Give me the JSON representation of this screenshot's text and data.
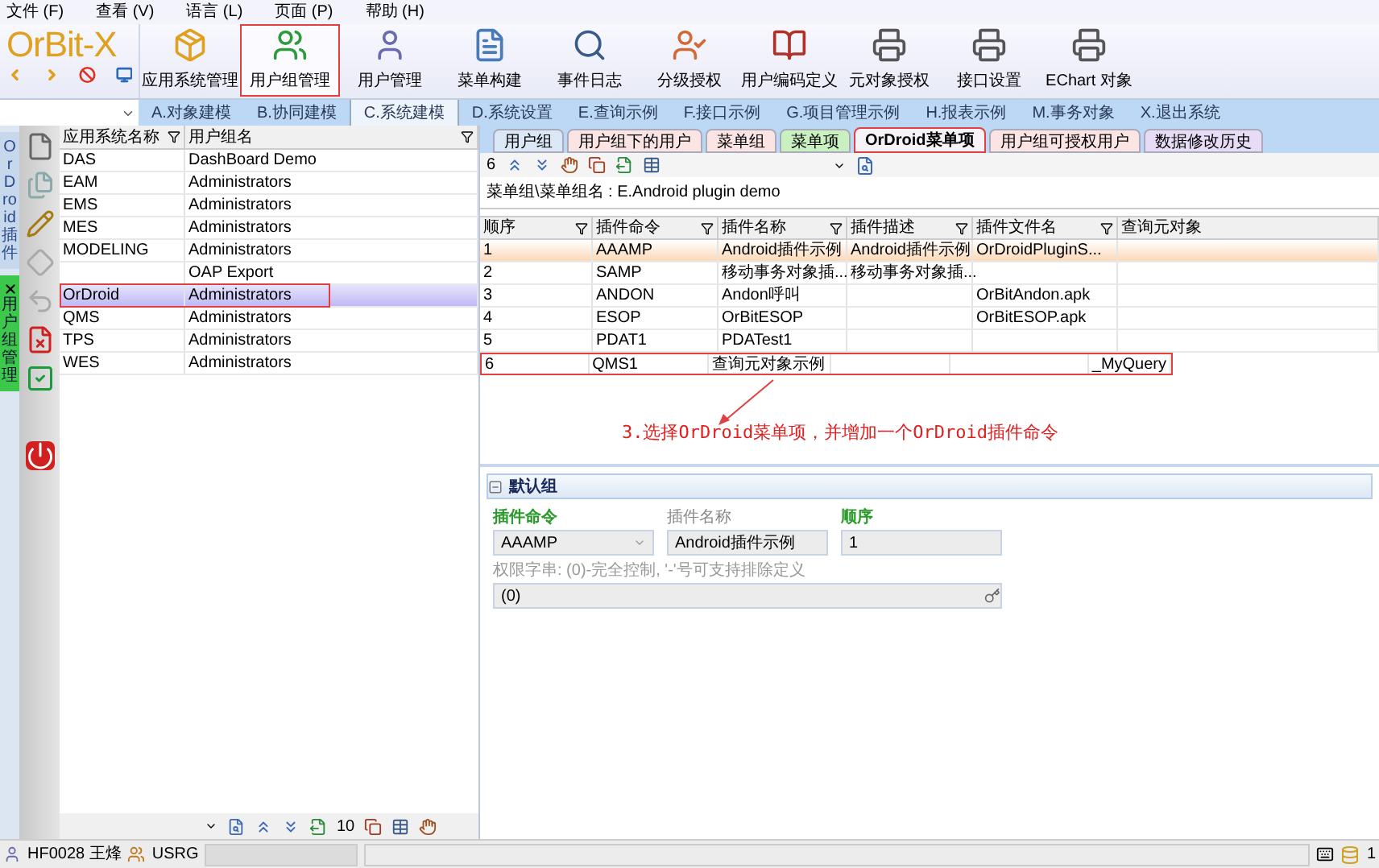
{
  "menu": [
    "文件 (F)",
    "查看 (V)",
    "语言 (L)",
    "页面 (P)",
    "帮助 (H)"
  ],
  "logo": "OrBit-X",
  "toolbar": [
    {
      "label": "应用系统管理",
      "annotated": false
    },
    {
      "label": "用户组管理",
      "annotated": true
    },
    {
      "label": "用户管理",
      "annotated": false
    },
    {
      "label": "菜单构建",
      "annotated": false
    },
    {
      "label": "事件日志",
      "annotated": false
    },
    {
      "label": "分级授权",
      "annotated": false
    },
    {
      "label": "用户编码定义",
      "annotated": false
    },
    {
      "label": "元对象授权",
      "annotated": false
    },
    {
      "label": "接口设置",
      "annotated": false
    },
    {
      "label": "EChart 对象",
      "annotated": false
    }
  ],
  "module_tabs": [
    {
      "label": "A.对象建模",
      "selected": false
    },
    {
      "label": "B.协同建模",
      "selected": false
    },
    {
      "label": "C.系统建模",
      "selected": true
    },
    {
      "label": "D.系统设置",
      "selected": false
    },
    {
      "label": "E.查询示例",
      "selected": false
    },
    {
      "label": "F.接口示例",
      "selected": false
    },
    {
      "label": "G.项目管理示例",
      "selected": false
    },
    {
      "label": "H.报表示例",
      "selected": false
    },
    {
      "label": "M.事务对象",
      "selected": false
    },
    {
      "label": "X.退出系统",
      "selected": false
    }
  ],
  "side_tabs": [
    {
      "label": "OrDroid插件",
      "selected": false
    },
    {
      "label": "用户组管理",
      "selected": true
    }
  ],
  "left_grid": {
    "columns": [
      "应用系统名称",
      "用户组名"
    ],
    "rows": [
      {
        "cells": [
          "DAS",
          "DashBoard Demo"
        ],
        "selected": false,
        "annotated": false
      },
      {
        "cells": [
          "EAM",
          "Administrators"
        ],
        "selected": false,
        "annotated": false
      },
      {
        "cells": [
          "EMS",
          "Administrators"
        ],
        "selected": false,
        "annotated": false
      },
      {
        "cells": [
          "MES",
          "Administrators"
        ],
        "selected": false,
        "annotated": false
      },
      {
        "cells": [
          "MODELING",
          "Administrators"
        ],
        "selected": false,
        "annotated": false
      },
      {
        "cells": [
          "",
          "OAP Export"
        ],
        "selected": false,
        "annotated": false
      },
      {
        "cells": [
          "OrDroid",
          "Administrators"
        ],
        "selected": true,
        "annotated": true
      },
      {
        "cells": [
          "QMS",
          "Administrators"
        ],
        "selected": false,
        "annotated": false
      },
      {
        "cells": [
          "TPS",
          "Administrators"
        ],
        "selected": false,
        "annotated": false
      },
      {
        "cells": [
          "WES",
          "Administrators"
        ],
        "selected": false,
        "annotated": false
      }
    ],
    "page_size": "10"
  },
  "sub_tabs": [
    {
      "label": "用户组",
      "selected": false,
      "annotated": false,
      "color": "#dbe8f7"
    },
    {
      "label": "用户组下的用户",
      "selected": false,
      "annotated": false,
      "color": "#fbe4e4"
    },
    {
      "label": "菜单组",
      "selected": false,
      "annotated": false,
      "color": "#fbe4e4"
    },
    {
      "label": "菜单项",
      "selected": false,
      "annotated": false,
      "color": "#c9f0c0"
    },
    {
      "label": "OrDroid菜单项",
      "selected": true,
      "annotated": true,
      "color": "#f6f2f6"
    },
    {
      "label": "用户组可授权用户",
      "selected": false,
      "annotated": false,
      "color": "#fbe4e4"
    },
    {
      "label": "数据修改历史",
      "selected": false,
      "annotated": false,
      "color": "#e6dcf5"
    }
  ],
  "right_toolbar": {
    "count": "6"
  },
  "breadcrumb": "菜单组\\菜单组名 : E.Android plugin demo",
  "right_grid": {
    "columns": [
      "顺序",
      "插件命令",
      "插件名称",
      "插件描述",
      "插件文件名",
      "查询元对象"
    ],
    "rows": [
      {
        "cells": [
          "1",
          "AAAMP",
          "Android插件示例",
          "Android插件示例",
          "OrDroidPluginS...",
          ""
        ],
        "selected": true,
        "annotated": false
      },
      {
        "cells": [
          "2",
          "SAMP",
          "移动事务对象插...",
          "移动事务对象插...",
          "",
          ""
        ],
        "selected": false,
        "annotated": false
      },
      {
        "cells": [
          "3",
          "ANDON",
          "Andon呼叫",
          "",
          "OrBitAndon.apk",
          ""
        ],
        "selected": false,
        "annotated": false
      },
      {
        "cells": [
          "4",
          "ESOP",
          "OrBitESOP",
          "",
          "OrBitESOP.apk",
          ""
        ],
        "selected": false,
        "annotated": false
      },
      {
        "cells": [
          "5",
          "PDAT1",
          "PDATest1",
          "",
          "",
          ""
        ],
        "selected": false,
        "annotated": false
      },
      {
        "cells": [
          "6",
          "QMS1",
          "查询元对象示例",
          "",
          "",
          "_MyQuery"
        ],
        "selected": false,
        "annotated": true
      }
    ]
  },
  "annotation": "3.选择OrDroid菜单项，并增加一个OrDroid插件命令",
  "form": {
    "group": "默认组",
    "expanded": true,
    "fields": [
      {
        "label": "插件命令",
        "value": "AAAMP",
        "kind": "select",
        "required": true
      },
      {
        "label": "插件名称",
        "value": "Android插件示例",
        "kind": "text",
        "required": false
      },
      {
        "label": "顺序",
        "value": "1",
        "kind": "text",
        "required": true
      }
    ],
    "hint": "权限字串: (0)-完全控制, '-'号可支持排除定义",
    "permission": "(0)"
  },
  "status_bar": {
    "user": "HF0028 王烽",
    "group": "USRG",
    "count": "1"
  }
}
